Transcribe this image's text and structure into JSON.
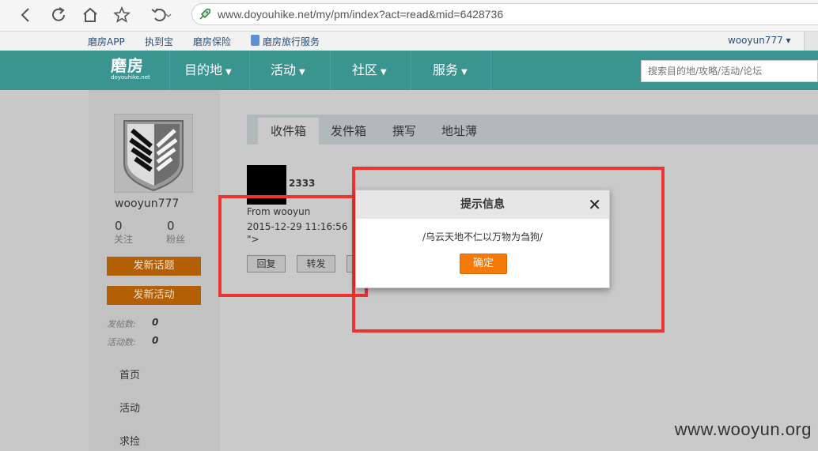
{
  "browser": {
    "url": "www.doyouhike.net/my/pm/index?act=read&mid=6428736"
  },
  "toplinks": {
    "items": [
      "磨房APP",
      "执到宝",
      "磨房保险",
      "磨房旅行服务"
    ],
    "user": "wooyun777 ▾"
  },
  "nav": {
    "logo": "磨房",
    "logo_sub": "doyouhike.net",
    "items": [
      "目的地",
      "活动",
      "社区",
      "服务"
    ],
    "search_placeholder": "搜索目的地/攻略/活动/论坛"
  },
  "sidebar": {
    "username": "wooyun777",
    "follow_count": "0",
    "follow_label": "关注",
    "fans_count": "0",
    "fans_label": "粉丝",
    "new_topic": "发新话题",
    "new_activity": "发新活动",
    "posts_label": "发帖数:",
    "posts_count": "0",
    "activities_label": "活动数:",
    "activities_count": "0",
    "links": [
      "首页",
      "活动",
      "求捡"
    ]
  },
  "tabs": [
    "收件箱",
    "发件箱",
    "撰写",
    "地址薄"
  ],
  "message": {
    "title": "2333",
    "from": "From wooyun",
    "date": "2015-12-29 11:16:56",
    "body": "\">",
    "reply": "回复",
    "forward": "转发"
  },
  "dialog": {
    "title": "提示信息",
    "close": "✕",
    "message": "/乌云天地不仁以万物为刍狗/",
    "ok": "确定"
  },
  "watermark": "www.wooyun.org",
  "colors": {
    "nav": "#3a9591",
    "orange_button": "#b35f06",
    "dialog_button": "#f47a0a",
    "annotation": "#ee3333"
  }
}
